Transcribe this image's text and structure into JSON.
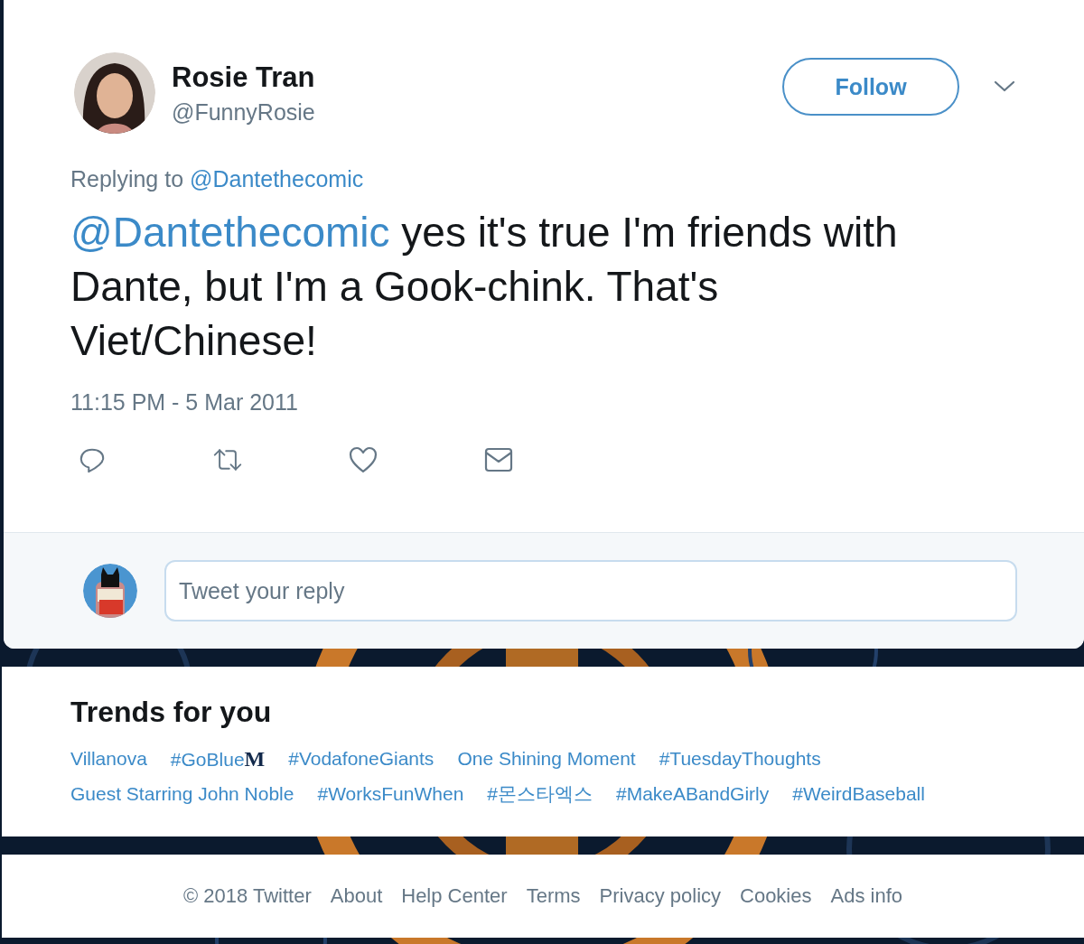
{
  "tweet": {
    "author": {
      "name": "Rosie Tran",
      "handle": "@FunnyRosie"
    },
    "follow_button": "Follow",
    "replying_to": {
      "label": "Replying to",
      "handle": "@Dantethecomic"
    },
    "mention": "@Dantethecomic",
    "text": "yes it's true I'm friends with Dante, but I'm a Gook-chink. That's Viet/Chinese!",
    "timestamp": "11:15 PM - 5 Mar 2011",
    "actions": [
      {
        "kind": "reply"
      },
      {
        "kind": "retweet"
      },
      {
        "kind": "like"
      },
      {
        "kind": "message"
      }
    ],
    "reply_box": {
      "placeholder": "Tweet your reply"
    }
  },
  "trends": {
    "title": "Trends for you",
    "items": [
      {
        "label": "Villanova"
      },
      {
        "label": "#GoBlue",
        "badge": "M"
      },
      {
        "label": "#VodafoneGiants"
      },
      {
        "label": "One Shining Moment"
      },
      {
        "label": "#TuesdayThoughts"
      },
      {
        "label": "Guest Starring John Noble"
      },
      {
        "label": "#WorksFunWhen"
      },
      {
        "label": "#몬스타엑스"
      },
      {
        "label": "#MakeABandGirly"
      },
      {
        "label": "#WeirdBaseball"
      }
    ]
  },
  "footer": [
    "© 2018 Twitter",
    "About",
    "Help Center",
    "Terms",
    "Privacy policy",
    "Cookies",
    "Ads info"
  ]
}
